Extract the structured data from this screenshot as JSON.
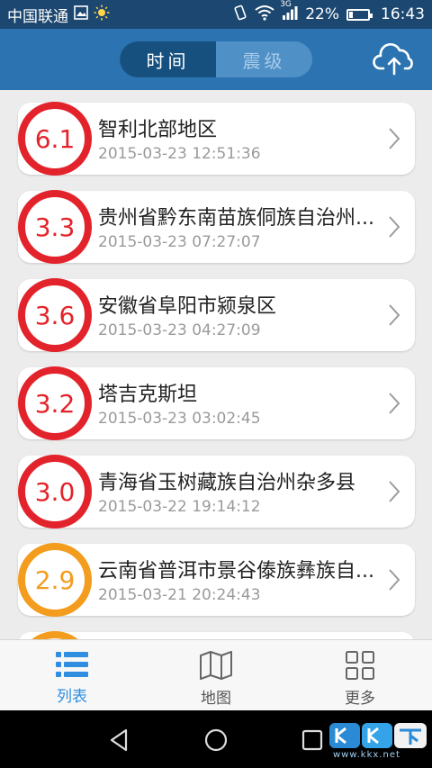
{
  "status_bar": {
    "carrier": "中国联通",
    "network": "3G",
    "battery": "22%",
    "battery_level": 0.22,
    "time": "16:43"
  },
  "header": {
    "tabs": [
      {
        "label": "时间",
        "active": true
      },
      {
        "label": "震级",
        "active": false
      }
    ],
    "upload_icon": "cloud-upload-icon"
  },
  "quakes": [
    {
      "magnitude": "6.1",
      "place": "智利北部地区",
      "time": "2015-03-23 12:51:36",
      "color": "#e3232b"
    },
    {
      "magnitude": "3.3",
      "place": "贵州省黔东南苗族侗族自治州...",
      "time": "2015-03-23 07:27:07",
      "color": "#e3232b"
    },
    {
      "magnitude": "3.6",
      "place": "安徽省阜阳市颍泉区",
      "time": "2015-03-23 04:27:09",
      "color": "#e3232b"
    },
    {
      "magnitude": "3.2",
      "place": "塔吉克斯坦",
      "time": "2015-03-23 03:02:45",
      "color": "#e3232b"
    },
    {
      "magnitude": "3.0",
      "place": "青海省玉树藏族自治州杂多县",
      "time": "2015-03-22 19:14:12",
      "color": "#e3232b"
    },
    {
      "magnitude": "2.9",
      "place": "云南省普洱市景谷傣族彝族自...",
      "time": "2015-03-21 20:24:43",
      "color": "#f39c1e"
    }
  ],
  "bottom_nav": [
    {
      "label": "列表",
      "icon": "list-icon",
      "active": true
    },
    {
      "label": "地图",
      "icon": "map-icon",
      "active": false
    },
    {
      "label": "更多",
      "icon": "grid-icon",
      "active": false
    }
  ],
  "colors": {
    "accent": "#2b73b1",
    "active_nav": "#2f8ee0",
    "inactive_nav": "#555555",
    "major_quake": "#e3232b",
    "minor_quake": "#f39c1e"
  },
  "watermark": {
    "text": "www.kkx.net"
  }
}
